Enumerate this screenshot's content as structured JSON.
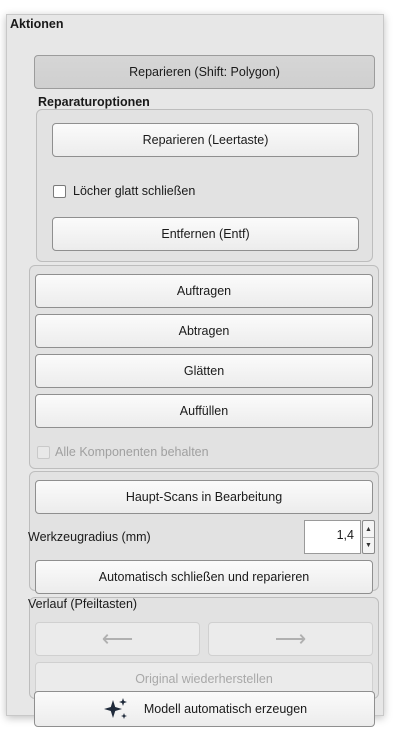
{
  "panel": {
    "title": "Aktionen"
  },
  "repair_polygon_button": "Reparieren (Shift: Polygon)",
  "repair_options": {
    "title": "Reparaturoptionen",
    "repair_button": "Reparieren (Leertaste)",
    "smooth_holes_label": "Löcher glatt schließen",
    "smooth_holes_checked": false,
    "remove_button": "Entfernen (Entf)"
  },
  "tools": {
    "apply_button": "Auftragen",
    "remove_button": "Abtragen",
    "smooth_button": "Glätten",
    "fill_button": "Auffüllen",
    "keep_components_label": "Alle Komponenten behalten",
    "keep_components_checked": false
  },
  "main_scans_button": "Haupt-Scans in Bearbeitung",
  "tool_radius": {
    "label": "Werkzeugradius (mm)",
    "value": "1,4"
  },
  "auto_close_repair_button": "Automatisch schließen und reparieren",
  "history": {
    "title": "Verlauf (Pfeiltasten)",
    "back_icon": "arrow-left",
    "forward_icon": "arrow-right",
    "back_glyph": "⟵",
    "forward_glyph": "⟶",
    "restore_button": "Original wiederherstellen"
  },
  "auto_model_button": "Modell automatisch erzeugen",
  "colors": {
    "panel_bg": "#e7e7e7",
    "button_bg": "#f4f4f4",
    "disabled_text": "#a8a8a8"
  }
}
